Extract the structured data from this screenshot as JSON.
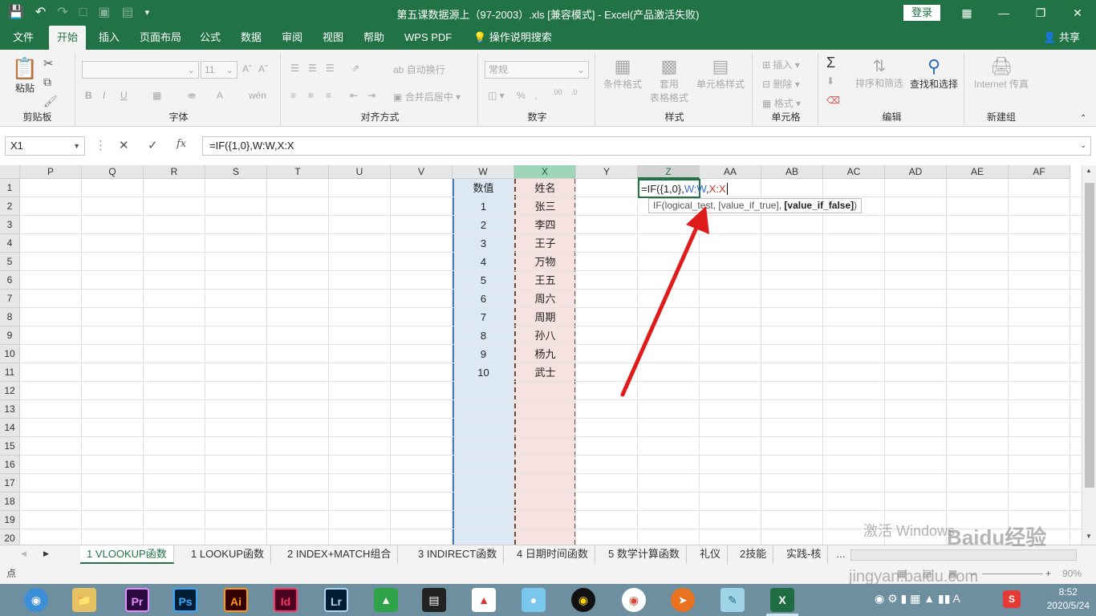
{
  "window": {
    "title": "第五课数据源上（97-2003）.xls  [兼容模式]  -  Excel(产品激活失败)",
    "login_label": "登录",
    "accent": "#217346"
  },
  "ribbon_tabs": [
    {
      "label": "文件"
    },
    {
      "label": "开始"
    },
    {
      "label": "插入"
    },
    {
      "label": "页面布局"
    },
    {
      "label": "公式"
    },
    {
      "label": "数据"
    },
    {
      "label": "审阅"
    },
    {
      "label": "视图"
    },
    {
      "label": "帮助"
    },
    {
      "label": "WPS PDF"
    },
    {
      "label": "操作说明搜索"
    }
  ],
  "share_label": "共享",
  "ribbon": {
    "paste_label": "粘贴",
    "font_size": "11",
    "wrap_label": "自动换行",
    "merge_label": "合并后居中",
    "number_format": "常规",
    "cond_format_label": "条件格式",
    "table_format_label1": "套用",
    "table_format_label2": "表格格式",
    "cell_style_label": "单元格样式",
    "insert_label": "插入",
    "delete_label": "删除",
    "format_label": "格式",
    "sort_label": "排序和筛选",
    "find_label": "查找和选择",
    "fax_label": "Internet 传真",
    "groups": {
      "clipboard": "剪贴板",
      "font": "字体",
      "align": "对齐方式",
      "number": "数字",
      "styles": "样式",
      "cells": "单元格",
      "edit": "编辑",
      "new_group": "新建组"
    }
  },
  "formula_bar": {
    "name_box": "X1",
    "fx": "fx",
    "formula": "=IF({1,0},W:W,X:X"
  },
  "columns": [
    "P",
    "Q",
    "R",
    "S",
    "T",
    "U",
    "V",
    "W",
    "X",
    "Y",
    "Z",
    "AA",
    "AB",
    "AC",
    "AD",
    "AE",
    "AF"
  ],
  "rows": [
    "1",
    "2",
    "3",
    "4",
    "5",
    "6",
    "7",
    "8",
    "9",
    "10",
    "11",
    "12",
    "13",
    "14",
    "15",
    "16",
    "17",
    "18",
    "19",
    "20"
  ],
  "cells": {
    "W": [
      "数值",
      "1",
      "2",
      "3",
      "4",
      "5",
      "6",
      "7",
      "8",
      "9",
      "10"
    ],
    "X": [
      "姓名",
      "张三",
      "李四",
      "王子",
      "万物",
      "王五",
      "周六",
      "周期",
      "孙八",
      "杨九",
      "武士"
    ]
  },
  "editing": {
    "part1": "=IF({1,0},",
    "part2": "W:W",
    "part3": ",",
    "part4": "X:X",
    "tooltip_fn": "IF(logical_test, [value_if_true], ",
    "tooltip_bold": "[value_if_false]",
    "tooltip_end": ")"
  },
  "sheet_tabs": [
    {
      "label": "1 VLOOKUP函数"
    },
    {
      "label": "1 LOOKUP函数"
    },
    {
      "label": "2 INDEX+MATCH组合"
    },
    {
      "label": "3 INDIRECT函数"
    },
    {
      "label": "4 日期时间函数"
    },
    {
      "label": "5 数学计算函数"
    },
    {
      "label": "礼仪"
    },
    {
      "label": "2技能"
    },
    {
      "label": "实践-核"
    }
  ],
  "status": {
    "mode": "点",
    "zoom": "90%"
  },
  "taskbar": {
    "time": "8:52",
    "date": "2020/5/24",
    "apps": [
      {
        "label": "Pr",
        "bg": "#2a0a3c",
        "fg": "#e28cff"
      },
      {
        "label": "Ps",
        "bg": "#001d34",
        "fg": "#31a8ff"
      },
      {
        "label": "Ai",
        "bg": "#330000",
        "fg": "#ff9a00"
      },
      {
        "label": "Id",
        "bg": "#49021f",
        "fg": "#ff3366"
      },
      {
        "label": "Lr",
        "bg": "#001d34",
        "fg": "#add5ec"
      }
    ]
  },
  "watermark": {
    "line1": "激活 Windows",
    "site": "jingyan.baidu.com",
    "brand": "Baidu经验"
  }
}
